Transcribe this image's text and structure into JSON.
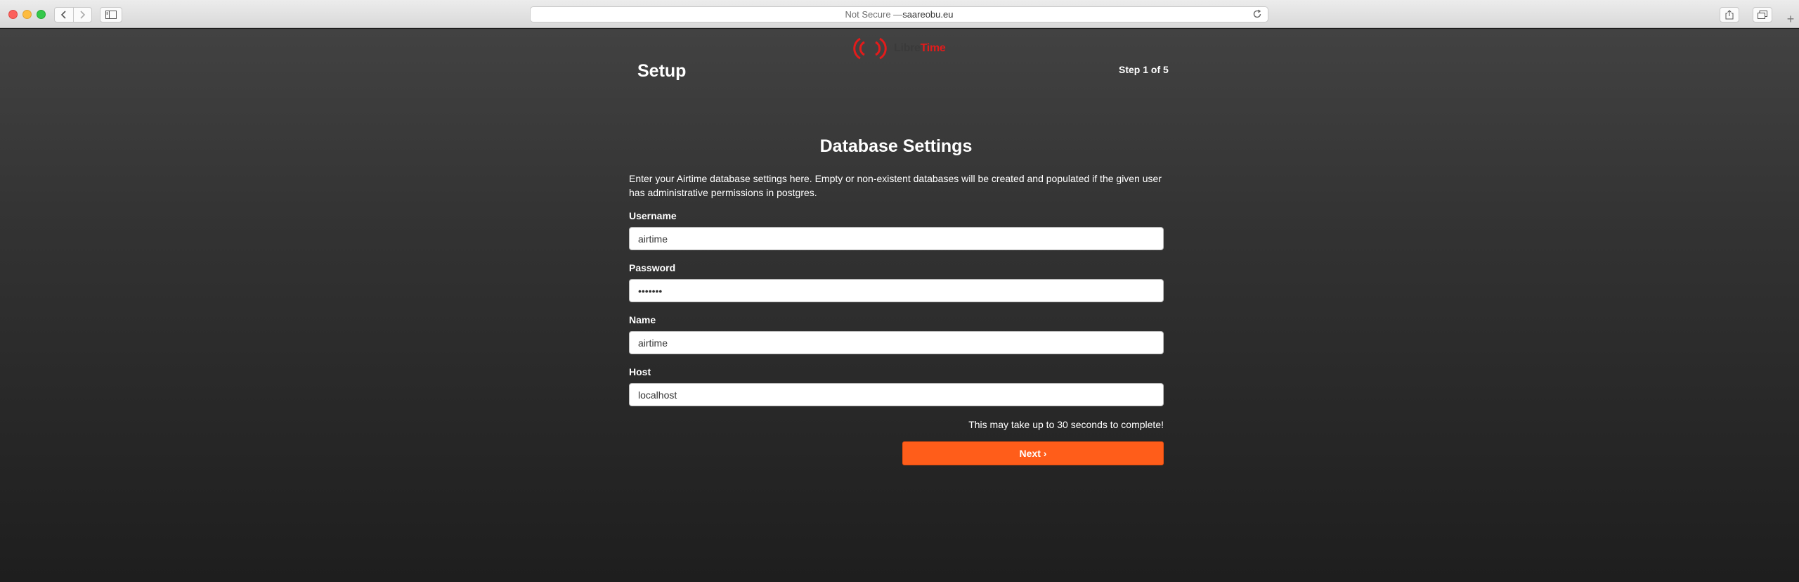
{
  "browser": {
    "url_prefix": "Not Secure — ",
    "url_domain": "saareobu.eu",
    "new_tab_label": "+"
  },
  "logo": {
    "text_part1": "Libre",
    "text_part2": "Time"
  },
  "header": {
    "title": "Setup",
    "step": "Step 1 of 5"
  },
  "main": {
    "section_title": "Database Settings",
    "intro": "Enter your Airtime database settings here. Empty or non-existent databases will be created and populated if the given user has administrative permissions in postgres.",
    "fields": [
      {
        "label": "Username",
        "value": "airtime"
      },
      {
        "label": "Password",
        "value": "airtime"
      },
      {
        "label": "Name",
        "value": "airtime"
      },
      {
        "label": "Host",
        "value": "localhost"
      }
    ],
    "note": "This may take up to 30 seconds to complete!",
    "next_label": "Next ›"
  },
  "colors": {
    "accent": "#ff5d1a",
    "logo_red": "#e31b1b"
  }
}
